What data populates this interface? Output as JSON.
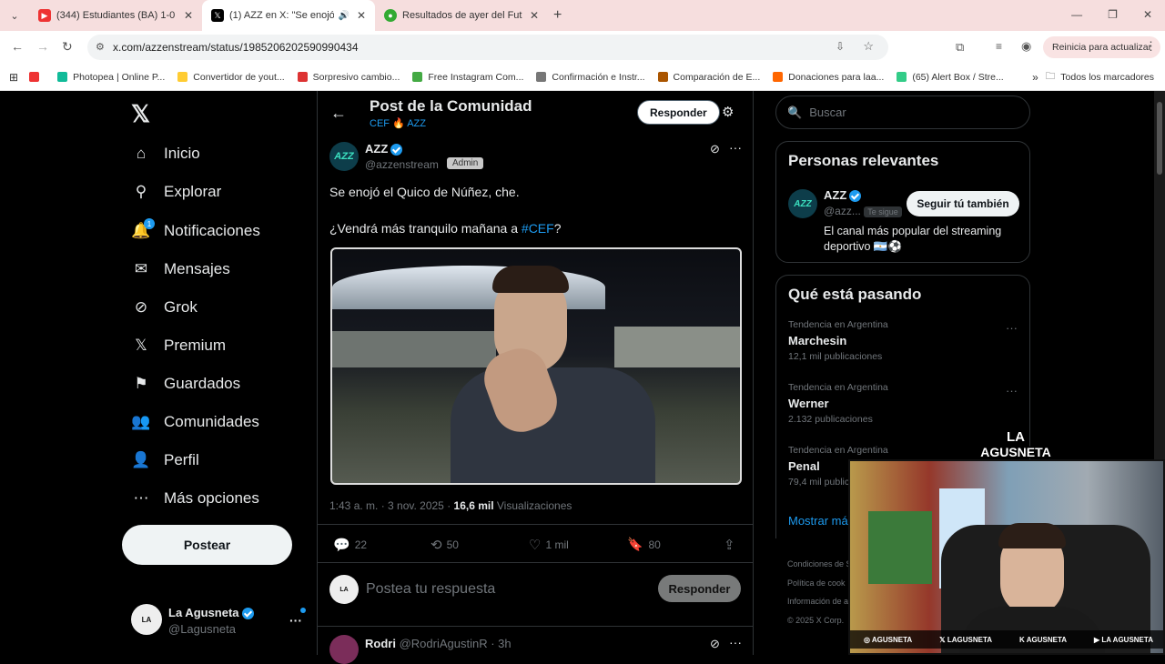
{
  "browser": {
    "tabs": [
      {
        "title": "(344) Estudiantes (BA) 1-0 Tristá",
        "active": false,
        "fav": "#e33"
      },
      {
        "title": "(1) AZZ en X: \"Se enojó el C",
        "active": true,
        "fav": "#000"
      },
      {
        "title": "Resultados de ayer del Futbol A",
        "active": false,
        "fav": "#3a3"
      }
    ],
    "url": "x.com/azzenstream/status/1985206202590990434",
    "update_label": "Reinicia para actualizar",
    "bookmarks": [
      {
        "label": "Photopea | Online P...",
        "color": "#1b9"
      },
      {
        "label": "Convertidor de yout...",
        "color": "#fc3"
      },
      {
        "label": "Sorpresivo cambio...",
        "color": "#d33"
      },
      {
        "label": "Free Instagram Com...",
        "color": "#4a4"
      },
      {
        "label": "Confirmación e Instr...",
        "color": "#777"
      },
      {
        "label": "Comparación de E...",
        "color": "#a50"
      },
      {
        "label": "Donaciones para laa...",
        "color": "#f60"
      },
      {
        "label": "(65) Alert Box / Stre...",
        "color": "#3c8"
      }
    ],
    "all_bookmarks": "Todos los marcadores"
  },
  "nav": {
    "items": [
      {
        "label": "Inicio",
        "icon": "home-icon"
      },
      {
        "label": "Explorar",
        "icon": "search-icon"
      },
      {
        "label": "Notificaciones",
        "icon": "bell-icon",
        "badge": "1"
      },
      {
        "label": "Mensajes",
        "icon": "mail-icon"
      },
      {
        "label": "Grok",
        "icon": "grok-icon"
      },
      {
        "label": "Premium",
        "icon": "x-icon"
      },
      {
        "label": "Guardados",
        "icon": "bookmark-icon"
      },
      {
        "label": "Comunidades",
        "icon": "people-icon"
      },
      {
        "label": "Perfil",
        "icon": "person-icon"
      },
      {
        "label": "Más opciones",
        "icon": "more-icon"
      }
    ],
    "post_button": "Postear",
    "account": {
      "name": "La Agusneta",
      "handle": "@Lagusneta"
    }
  },
  "post": {
    "header_title": "Post de la Comunidad",
    "header_sub_a": "CEF",
    "header_sub_b": "AZZ",
    "reply_button": "Responder",
    "author": "AZZ",
    "handle": "@azzenstream",
    "role": "Admin",
    "text1": "Se enojó el Quico de Núñez, che.",
    "text2a": "¿Vendrá más tranquilo mañana a ",
    "hashtag": "#CEF",
    "text2b": "?",
    "time": "1:43 a. m. · 3 nov. 2025 · ",
    "views": "16,6 mil",
    "views_label": " Visualizaciones",
    "replies": "22",
    "reposts": "50",
    "likes": "1 mil",
    "bookmarks": "80",
    "reply_placeholder": "Postea tu respuesta",
    "reply_submit": "Responder",
    "next_author": "Rodri",
    "next_handle": "@RodriAgustinR · 3h"
  },
  "sidebar": {
    "search_placeholder": "Buscar",
    "relevant_title": "Personas relevantes",
    "relevant": {
      "name": "AZZ",
      "handle": "@azz...",
      "follows_you": "Te sigue",
      "follow_button": "Seguir tú también",
      "bio": "El canal más popular del streaming deportivo"
    },
    "trends_title": "Qué está pasando",
    "trends": [
      {
        "context": "Tendencia en Argentina",
        "name": "Marchesin",
        "count": "12,1 mil publicaciones"
      },
      {
        "context": "Tendencia en Argentina",
        "name": "Werner",
        "count": "2.132 publicaciones"
      },
      {
        "context": "Tendencia en Argentina",
        "name": "Penal",
        "count": "79,4 mil publicaciones"
      }
    ],
    "show_more": "Mostrar más",
    "footer": [
      "Condiciones de S",
      "Política de cook",
      "Información de a",
      "© 2025 X Corp."
    ]
  },
  "overlay": {
    "logo_line1": "LA",
    "logo_line2": "AGUSNETA",
    "socials": [
      "AGUSNETA",
      "LAGUSNETA",
      "AGUSNETA",
      "LA AGUSNETA"
    ]
  }
}
